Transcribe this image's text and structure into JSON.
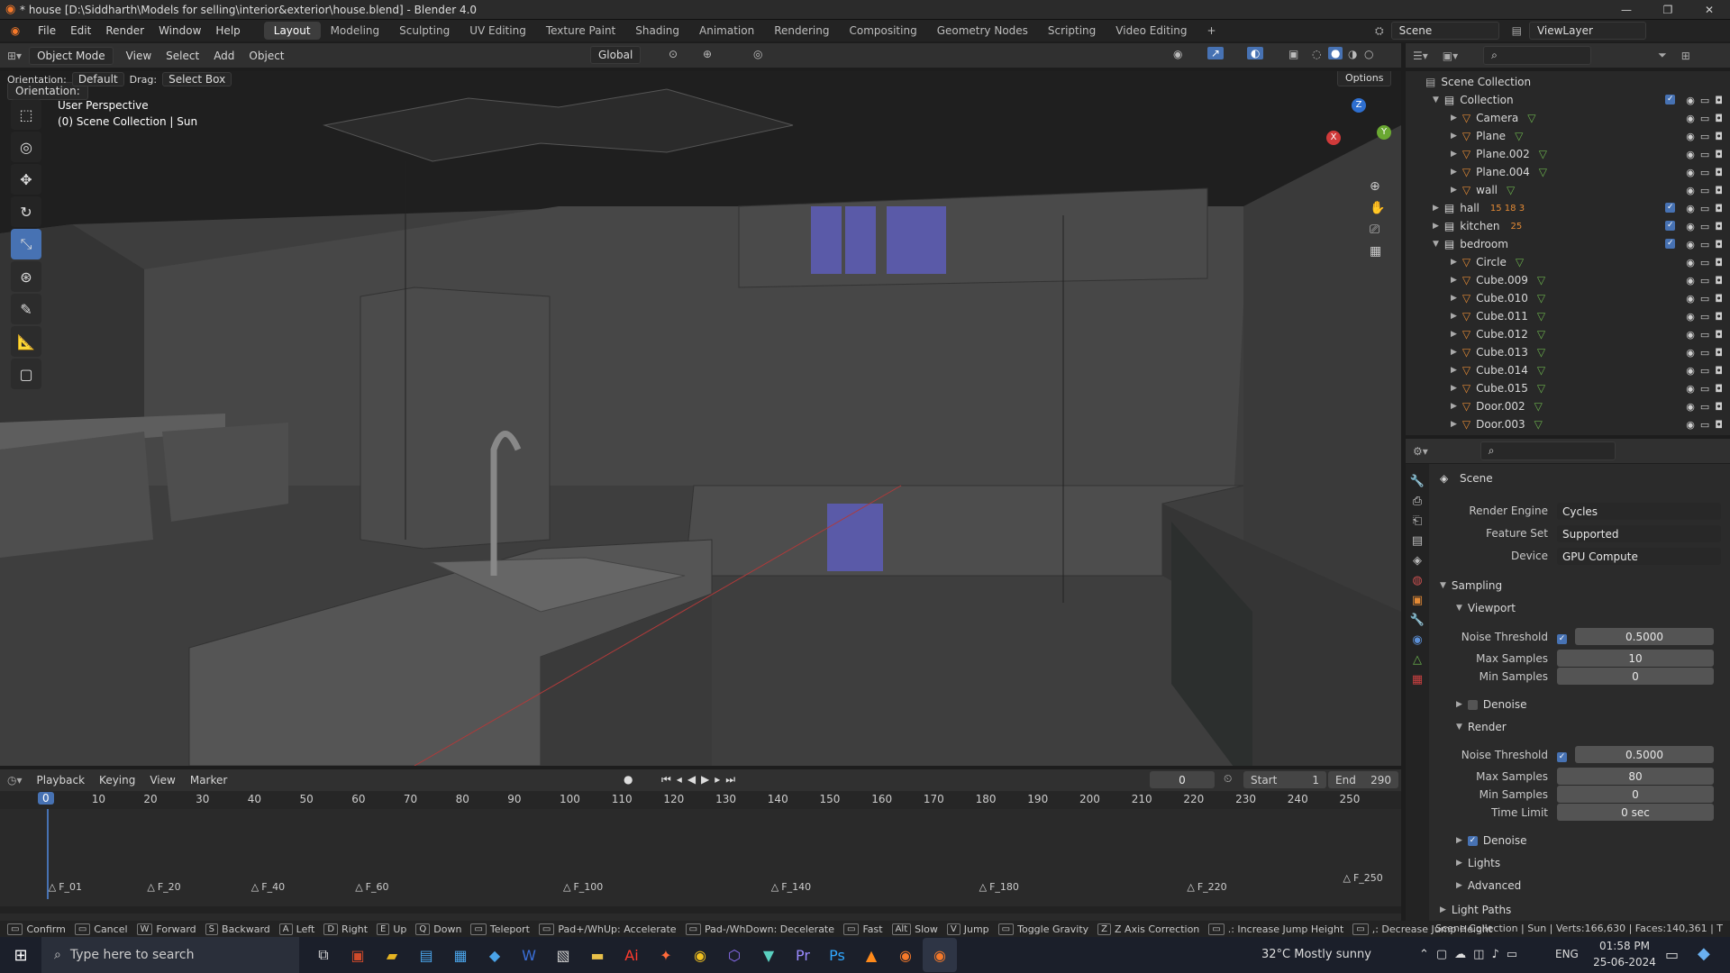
{
  "window": {
    "title": "* house [D:\\Siddharth\\Models for selling\\interior&exterior\\house.blend] - Blender 4.0",
    "minimize": "—",
    "maximize": "❐",
    "close": "✕"
  },
  "menubar": {
    "items": [
      "File",
      "Edit",
      "Render",
      "Window",
      "Help"
    ],
    "workspaces": [
      "Layout",
      "Modeling",
      "Sculpting",
      "UV Editing",
      "Texture Paint",
      "Shading",
      "Animation",
      "Rendering",
      "Compositing",
      "Geometry Nodes",
      "Scripting",
      "Video Editing"
    ],
    "active_workspace": "Layout",
    "add_tab": "+",
    "scene_label": "Scene",
    "viewlayer_label": "ViewLayer"
  },
  "viewport_header": {
    "mode": "Object Mode",
    "menus": [
      "View",
      "Select",
      "Add",
      "Object"
    ],
    "transform": "Global",
    "orientation_label": "Orientation:",
    "orientation_value": "Default",
    "drag_label": "Drag:",
    "drag_value": "Select Box",
    "options": "Options"
  },
  "viewport": {
    "perspective": "User Perspective",
    "collection": "(0) Scene Collection | Sun",
    "gizmo_axes": [
      "X",
      "Y",
      "Z"
    ]
  },
  "outliner": {
    "root": "Scene Collection",
    "rows": [
      {
        "name": "Collection",
        "kind": "collection",
        "expanded": true
      },
      {
        "name": "Camera",
        "kind": "object"
      },
      {
        "name": "Plane",
        "kind": "object"
      },
      {
        "name": "Plane.002",
        "kind": "object"
      },
      {
        "name": "Plane.004",
        "kind": "object"
      },
      {
        "name": "wall",
        "kind": "object"
      },
      {
        "name": "hall",
        "kind": "collection",
        "expanded": false,
        "badges": "15  18  3"
      },
      {
        "name": "kitchen",
        "kind": "collection",
        "expanded": false,
        "badges": "25"
      },
      {
        "name": "bedroom",
        "kind": "collection",
        "expanded": true
      },
      {
        "name": "Circle",
        "kind": "object"
      },
      {
        "name": "Cube.009",
        "kind": "object"
      },
      {
        "name": "Cube.010",
        "kind": "object"
      },
      {
        "name": "Cube.011",
        "kind": "object"
      },
      {
        "name": "Cube.012",
        "kind": "object"
      },
      {
        "name": "Cube.013",
        "kind": "object"
      },
      {
        "name": "Cube.014",
        "kind": "object"
      },
      {
        "name": "Cube.015",
        "kind": "object"
      },
      {
        "name": "Door.002",
        "kind": "object"
      },
      {
        "name": "Door.003",
        "kind": "object"
      }
    ]
  },
  "properties": {
    "breadcrumb": "Scene",
    "render_engine_label": "Render Engine",
    "render_engine": "Cycles",
    "feature_set_label": "Feature Set",
    "feature_set": "Supported",
    "device_label": "Device",
    "device": "GPU Compute",
    "sampling": "Sampling",
    "viewport_section": "Viewport",
    "noise_threshold_label": "Noise Threshold",
    "viewport_noise": "0.5000",
    "max_samples_label": "Max Samples",
    "viewport_max": "10",
    "min_samples_label": "Min Samples",
    "viewport_min": "0",
    "denoise_label": "Denoise",
    "render_section": "Render",
    "render_noise": "0.5000",
    "render_max": "80",
    "render_min": "0",
    "time_limit_label": "Time Limit",
    "time_limit": "0 sec",
    "lights": "Lights",
    "advanced": "Advanced",
    "light_paths": "Light Paths"
  },
  "timeline": {
    "menus": [
      "Playback",
      "Keying",
      "View",
      "Marker"
    ],
    "current_frame": "0",
    "start_label": "Start",
    "start": "1",
    "end_label": "End",
    "end": "290",
    "ticks": [
      "0",
      "10",
      "20",
      "30",
      "40",
      "50",
      "60",
      "70",
      "80",
      "90",
      "100",
      "110",
      "120",
      "130",
      "140",
      "150",
      "160",
      "170",
      "180",
      "190",
      "200",
      "210",
      "220",
      "230",
      "240",
      "250"
    ],
    "markers": [
      "F_01",
      "F_20",
      "F_40",
      "F_60",
      "F_100",
      "F_140",
      "F_180",
      "F_220",
      "F_250"
    ]
  },
  "statusbar": {
    "items": [
      "Confirm",
      "Cancel",
      "Forward",
      "Backward",
      "Left",
      "Right",
      "Up",
      "Down",
      "Teleport",
      "Pad+/WhUp: Accelerate",
      "Pad-/WhDown: Decelerate",
      "Fast",
      "Slow",
      "Jump",
      "Toggle Gravity",
      "Z Axis Correction",
      ".: Increase Jump Height",
      ",: Decrease Jump Height"
    ],
    "keys": [
      "",
      "",
      "W",
      "S",
      "A",
      "D",
      "E",
      "Q",
      "",
      "",
      "",
      "",
      "Alt",
      "V",
      "",
      "Z",
      "",
      ""
    ],
    "stats": "Scene Collection | Sun | Verts:166,630 | Faces:140,361 | T"
  },
  "taskbar": {
    "search_placeholder": "Type here to search",
    "weather": "32°C  Mostly sunny",
    "lang": "ENG",
    "time": "01:58 PM",
    "date": "25-06-2024"
  },
  "colors": {
    "accent": "#4772b3",
    "viewport_bg": "#3a3a3a",
    "panel_bg": "#2b2b2b"
  }
}
